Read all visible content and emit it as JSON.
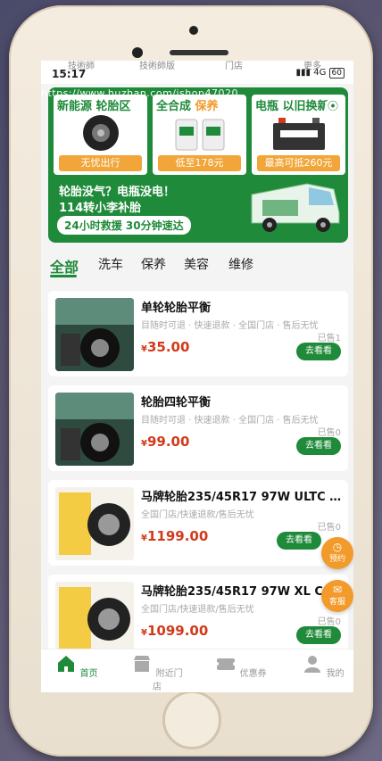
{
  "status_bar": {
    "time": "15:17",
    "signal": "4G",
    "battery": "60"
  },
  "ghost_tabs": [
    "技術師",
    "技術師版",
    "门店",
    "更多"
  ],
  "watermark": "https://www.huzhan.com/ishop47020",
  "banner": {
    "promos": [
      {
        "title_a": "新能源",
        "title_b": "轮胎区",
        "button": "无忧出行"
      },
      {
        "title_a": "全合成",
        "title_b": "保养",
        "button": "低至178元"
      },
      {
        "title_a": "电瓶",
        "title_b": "以旧换新",
        "button": "最高可抵260元"
      }
    ],
    "slogan_line1": "轮胎没气？电瓶没电！",
    "slogan_line2": "114转小李补胎",
    "slogan_line3": "24小时救援 30分钟速达"
  },
  "categories": [
    "全部",
    "洗车",
    "保养",
    "美容",
    "维修"
  ],
  "products": [
    {
      "title": "单轮轮胎平衡",
      "tags": "目随时可退 · 快速退款 · 全国门店 · 售后无忧",
      "sold": "已售1",
      "price_symbol": "¥",
      "price": "35.00",
      "button": "去看看"
    },
    {
      "title": "轮胎四轮平衡",
      "tags": "目随时可退 · 快速退款 · 全国门店 · 售后无忧",
      "sold": "已售0",
      "price_symbol": "¥",
      "price": "99.00",
      "button": "去看看"
    },
    {
      "title": "马牌轮胎235/45R17 97W ULTC …",
      "tags": "全国门店/快速退款/售后无忧",
      "sold": "已售0",
      "price_symbol": "¥",
      "price": "1199.00",
      "button": "去看看"
    },
    {
      "title": "马牌轮胎235/45R17 97W XL CC",
      "tags": "全国门店/快速退款/售后无忧",
      "sold": "已售0",
      "price_symbol": "¥",
      "price": "1099.00",
      "button": "去看看"
    }
  ],
  "float_buttons": {
    "booking": "预约",
    "service": "客服"
  },
  "tabbar": [
    "首页",
    "附近门店",
    "优惠券",
    "我的"
  ],
  "colors": {
    "brand": "#1f8a3a",
    "price": "#d23a1a",
    "accent": "#f29a2a"
  }
}
